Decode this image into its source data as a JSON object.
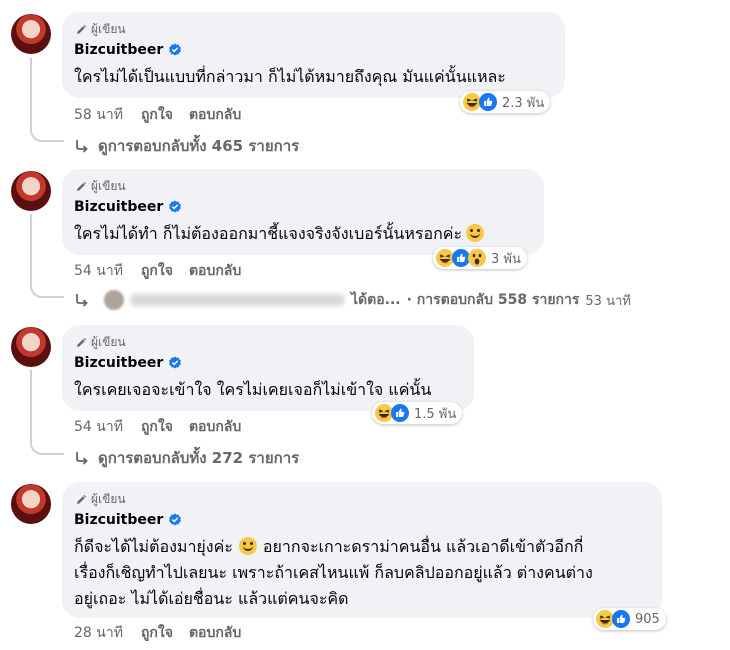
{
  "comments": [
    {
      "author_badge": "ผู้เขียน",
      "name": "Bizcuitbeer",
      "text": "ใครไม่ได้เป็นแบบที่กล่าวมา ก็ไม่ได้หมายถึงคุณ มันแค่นั้นแหละ",
      "reaction_count": "2.3 พัน",
      "time": "58 นาที",
      "like": "ถูกใจ",
      "reply": "ตอบกลับ",
      "replies_label": "ดูการตอบกลับทั้ง 465 รายการ"
    },
    {
      "author_badge": "ผู้เขียน",
      "name": "Bizcuitbeer",
      "text": "ใครไม่ได้ทำ ก็ไม่ต้องออกมาชี้แจงจริงจังเบอร์นั้นหรอกค่ะ",
      "reaction_count": "3 พัน",
      "time": "54 นาที",
      "like": "ถูกใจ",
      "reply": "ตอบกลับ",
      "reply_preview_suffix": "ได้ตอ...",
      "replies_label": "· การตอบกลับ 558 รายการ",
      "reply_time": "53 นาที"
    },
    {
      "author_badge": "ผู้เขียน",
      "name": "Bizcuitbeer",
      "text": "ใครเคยเจอจะเข้าใจ ใครไม่เคยเจอก็ไม่เข้าใจ แค่นั้น",
      "reaction_count": "1.5 พัน",
      "time": "54 นาที",
      "like": "ถูกใจ",
      "reply": "ตอบกลับ",
      "replies_label": "ดูการตอบกลับทั้ง 272 รายการ"
    },
    {
      "author_badge": "ผู้เขียน",
      "name": "Bizcuitbeer",
      "text_line1a": "ก็ดีจะได้ไม่ต้องมายุ่งค่ะ",
      "text_line1b": "อยากจะเกาะดราม่าคนอื่น แล้วเอาดีเข้าตัวอีกกี่",
      "text_line2": "เรื่องก็เชิญทำไปเลยนะ เพราะถ้าเคสไหนแพ้ ก็ลบคลิปออกอยู่แล้ว ต่างคนต่าง",
      "text_line3": "อยู่เถอะ ไม่ได้เอ่ยชื่อนะ แล้วแต่คนจะคิด",
      "reaction_count": "905",
      "time": "28 นาที",
      "like": "ถูกใจ",
      "reply": "ตอบกลับ"
    }
  ],
  "colors": {
    "bubble": "#f0f2f5",
    "secondary_text": "#65676b",
    "verified": "#1877f2",
    "like": "#1877f2",
    "haha": "#f7b125"
  },
  "icons": [
    "pencil-icon",
    "verified-badge-icon",
    "haha-reaction-icon",
    "like-reaction-icon",
    "wow-reaction-icon",
    "reply-arrow-icon",
    "smile-emoji-icon"
  ]
}
